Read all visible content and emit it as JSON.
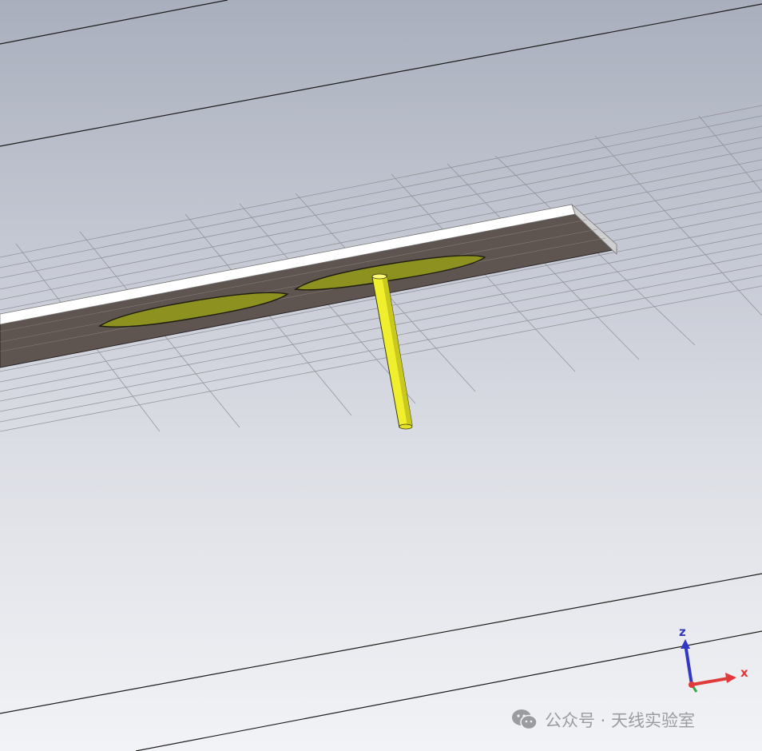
{
  "axes": {
    "z_label": "z",
    "x_label": "x",
    "colors": {
      "x": "#e03a3a",
      "y": "#2fa84a",
      "z": "#3338c4"
    }
  },
  "model": {
    "substrate_color": "#5e5450",
    "substrate_edge_color": "#ffffff",
    "patch_color": "#8c9120",
    "feed_color": "#f0ef2e",
    "background_top": "#a9afbd",
    "background_bottom": "#f2f3f6"
  },
  "watermark": {
    "icon": "wechat-icon",
    "text": "公众号 · 天线实验室"
  }
}
